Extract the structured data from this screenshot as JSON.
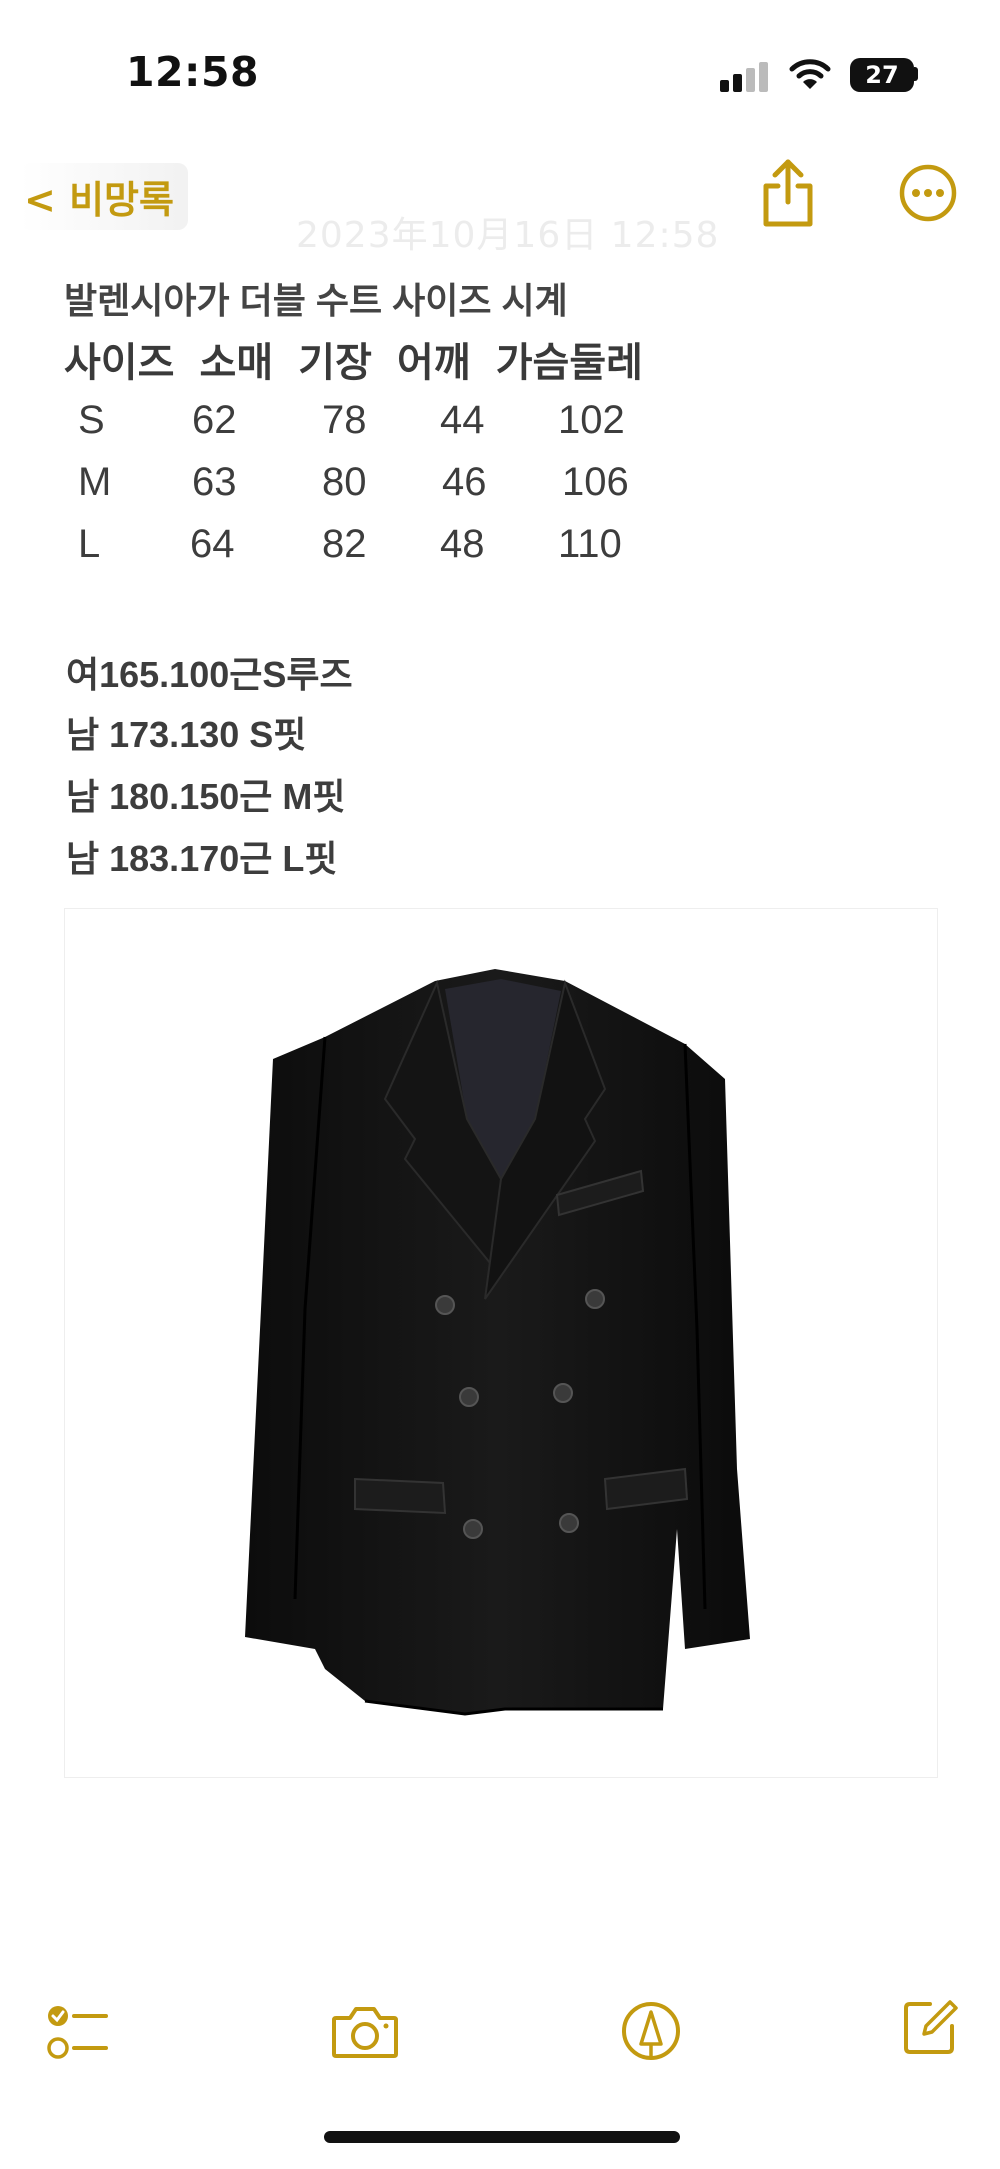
{
  "status_bar": {
    "time": "12:58",
    "battery": "27"
  },
  "nav": {
    "back_label": "< 비망록",
    "share_icon": "share-icon",
    "more_icon": "ellipsis-circle-icon",
    "accent_color": "#c39a10"
  },
  "note": {
    "date_faint": "2023年10月16日 12:58",
    "title": "발렌시아가 더블 수트 사이즈 시계",
    "table": {
      "headers": [
        "사이즈",
        "소매",
        "기장",
        "어깨",
        "가슴둘레"
      ],
      "rows": [
        [
          "S",
          "62",
          "78",
          "44",
          "102"
        ],
        [
          "M",
          "63",
          "80",
          "46",
          "106"
        ],
        [
          "L",
          "64",
          "82",
          "48",
          "110"
        ]
      ]
    },
    "fit_lines": [
      "여165.100근S루즈",
      "남 173.130 S핏",
      "남 180.150근 M핏",
      "남 183.170근 L핏"
    ]
  },
  "toolbar": {
    "icons": [
      "checklist-icon",
      "camera-icon",
      "markup-pen-icon",
      "compose-icon"
    ]
  }
}
